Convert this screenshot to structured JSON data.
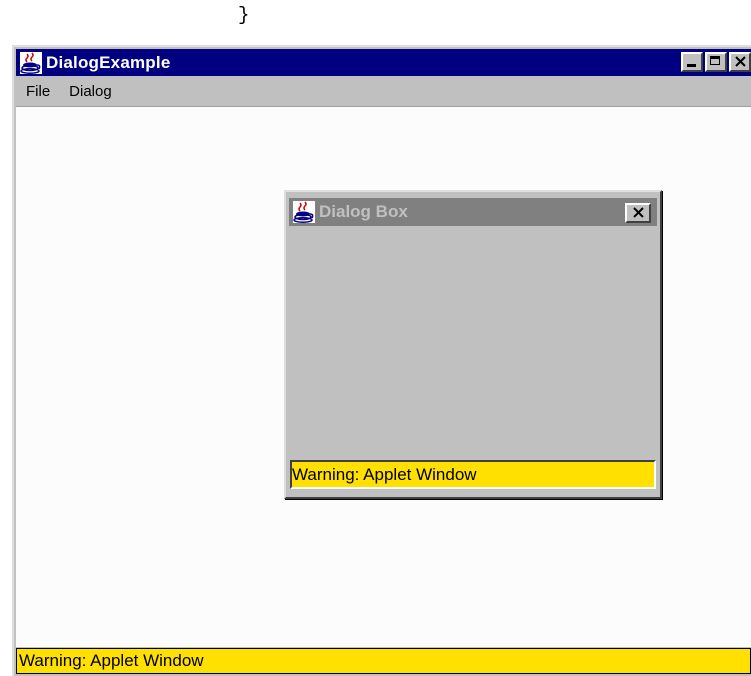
{
  "code_snippet": "}",
  "main_window": {
    "title": "DialogExample",
    "menu": [
      "File",
      "Dialog"
    ],
    "status": "Warning: Applet Window",
    "icon": "java-coffee-cup-icon"
  },
  "dialog": {
    "title": "Dialog Box",
    "status": "Warning: Applet Window",
    "icon": "java-coffee-cup-icon"
  },
  "colors": {
    "title_active": "#000080",
    "title_inactive": "#808080",
    "warning_bg": "#ffe000",
    "face": "#c0c0c0"
  }
}
